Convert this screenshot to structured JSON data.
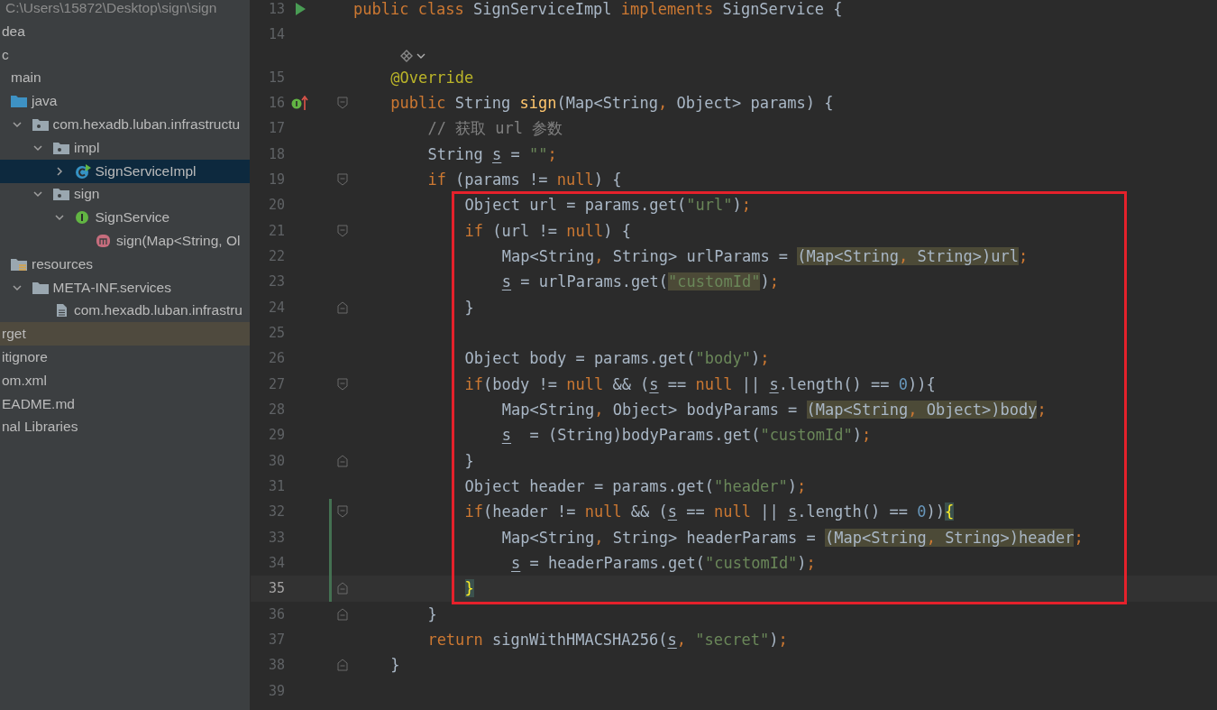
{
  "project_tree": {
    "path": "C:\\Users\\15872\\Desktop\\sign\\sign",
    "items": [
      {
        "label": "dea",
        "selected": false,
        "excluded": false
      },
      {
        "label": "c",
        "selected": false,
        "excluded": false,
        "children": [
          {
            "label": "main",
            "selected": false,
            "excluded": false,
            "children": [
              {
                "label": "java",
                "kind": "source-folder",
                "selected": false,
                "excluded": false,
                "children": [
                  {
                    "label": "com.hexadb.luban.infrastructu",
                    "kind": "package",
                    "expanded": true,
                    "selected": false,
                    "excluded": false,
                    "children": [
                      {
                        "label": "impl",
                        "kind": "package",
                        "expanded": true,
                        "selected": false,
                        "excluded": false,
                        "children": [
                          {
                            "label": "SignServiceImpl",
                            "kind": "class",
                            "expanded": false,
                            "selected": true,
                            "excluded": false
                          }
                        ]
                      },
                      {
                        "label": "sign",
                        "kind": "package",
                        "expanded": true,
                        "selected": false,
                        "excluded": false,
                        "children": [
                          {
                            "label": "SignService",
                            "kind": "interface",
                            "expanded": true,
                            "selected": false,
                            "excluded": false,
                            "children": [
                              {
                                "label": "sign(Map<String, Ol",
                                "kind": "method",
                                "selected": false,
                                "excluded": false
                              }
                            ]
                          }
                        ]
                      }
                    ]
                  }
                ]
              },
              {
                "label": "resources",
                "kind": "resources",
                "selected": false,
                "excluded": false,
                "children": [
                  {
                    "label": "META-INF.services",
                    "kind": "folder",
                    "expanded": true,
                    "selected": false,
                    "excluded": false,
                    "children": [
                      {
                        "label": "com.hexadb.luban.infrastru",
                        "kind": "file",
                        "selected": false,
                        "excluded": false
                      }
                    ]
                  }
                ]
              }
            ]
          }
        ]
      },
      {
        "label": "rget",
        "selected": false,
        "excluded": true
      },
      {
        "label": "itignore",
        "selected": false,
        "excluded": false
      },
      {
        "label": "om.xml",
        "selected": false,
        "excluded": false
      },
      {
        "label": "EADME.md",
        "selected": false,
        "excluded": false
      },
      {
        "label": "nal Libraries",
        "selected": false,
        "excluded": false
      }
    ]
  },
  "editor": {
    "lines": [
      {
        "n": "13",
        "gutter": {
          "kind": "run"
        },
        "current": false,
        "changed": false,
        "tokens": [
          {
            "t": "public class ",
            "kind": "kw"
          },
          {
            "t": "SignServiceImpl ",
            "kind": "plain"
          },
          {
            "t": "implements ",
            "kind": "kw"
          },
          {
            "t": "SignService {",
            "kind": "plain"
          }
        ],
        "children": [
          {
            "n": "14",
            "current": false,
            "changed": false
          },
          {
            "kind": "hint"
          },
          {
            "n": "15",
            "current": false,
            "changed": false,
            "tokens": [
              {
                "t": "@Override",
                "kind": "ann"
              }
            ]
          },
          {
            "n": "16",
            "gutter": {
              "kind": "implements"
            },
            "fold": {
              "kind": "start"
            },
            "current": false,
            "changed": false,
            "tokens": [
              {
                "t": "public ",
                "kind": "kw"
              },
              {
                "t": "String ",
                "kind": "plain"
              },
              {
                "t": "sign",
                "kind": "fn"
              },
              {
                "t": "(Map<String",
                "kind": "plain"
              },
              {
                "t": ", ",
                "kind": "punct"
              },
              {
                "t": "Object> params) {",
                "kind": "plain"
              }
            ],
            "children": [
              {
                "n": "17",
                "current": false,
                "changed": false,
                "tokens": [
                  {
                    "t": "// 获取 url 参数",
                    "kind": "cmt"
                  }
                ]
              },
              {
                "n": "18",
                "current": false,
                "changed": false,
                "tokens": [
                  {
                    "t": "String ",
                    "kind": "plain"
                  },
                  {
                    "t": "s",
                    "kind": "var"
                  },
                  {
                    "t": " = ",
                    "kind": "plain"
                  },
                  {
                    "t": "\"\"",
                    "kind": "str"
                  },
                  {
                    "t": ";",
                    "kind": "punct"
                  }
                ]
              },
              {
                "n": "19",
                "fold": {
                  "kind": "start"
                },
                "current": false,
                "changed": false,
                "tokens": [
                  {
                    "t": "if ",
                    "kind": "kw"
                  },
                  {
                    "t": "(params != ",
                    "kind": "plain"
                  },
                  {
                    "t": "null",
                    "kind": "kw"
                  },
                  {
                    "t": ") {",
                    "kind": "plain"
                  }
                ],
                "children": [
                  {
                    "n": "20",
                    "current": false,
                    "changed": false,
                    "tokens": [
                      {
                        "t": "Object url = params.get(",
                        "kind": "plain"
                      },
                      {
                        "t": "\"url\"",
                        "kind": "str"
                      },
                      {
                        "t": ")",
                        "kind": "plain"
                      },
                      {
                        "t": ";",
                        "kind": "punct"
                      }
                    ]
                  },
                  {
                    "n": "21",
                    "fold": {
                      "kind": "start"
                    },
                    "current": false,
                    "changed": false,
                    "tokens": [
                      {
                        "t": "if ",
                        "kind": "kw"
                      },
                      {
                        "t": "(url != ",
                        "kind": "plain"
                      },
                      {
                        "t": "null",
                        "kind": "kw"
                      },
                      {
                        "t": ") {",
                        "kind": "plain"
                      }
                    ],
                    "children": [
                      {
                        "n": "22",
                        "current": false,
                        "changed": false,
                        "tokens": [
                          {
                            "t": "Map<String",
                            "kind": "plain"
                          },
                          {
                            "t": ", ",
                            "kind": "punct"
                          },
                          {
                            "t": "String> urlParams = ",
                            "kind": "plain"
                          },
                          {
                            "t": "(Map<String",
                            "kind": "cast"
                          },
                          {
                            "t": ", ",
                            "kind": "cast-punct"
                          },
                          {
                            "t": "String>)url",
                            "kind": "cast"
                          },
                          {
                            "t": ";",
                            "kind": "punct"
                          }
                        ]
                      },
                      {
                        "n": "23",
                        "current": false,
                        "changed": false,
                        "tokens": [
                          {
                            "t": "s",
                            "kind": "var"
                          },
                          {
                            "t": " = urlParams.get(",
                            "kind": "plain"
                          },
                          {
                            "t": "\"customId\"",
                            "kind": "str-hl"
                          },
                          {
                            "t": ")",
                            "kind": "plain"
                          },
                          {
                            "t": ";",
                            "kind": "punct"
                          }
                        ]
                      }
                    ]
                  },
                  {
                    "n": "24",
                    "fold": {
                      "kind": "end"
                    },
                    "current": false,
                    "changed": false,
                    "tokens": [
                      {
                        "t": "}",
                        "kind": "plain"
                      }
                    ]
                  },
                  {
                    "n": "25",
                    "current": false,
                    "changed": false
                  },
                  {
                    "n": "26",
                    "current": false,
                    "changed": false,
                    "tokens": [
                      {
                        "t": "Object body = params.get(",
                        "kind": "plain"
                      },
                      {
                        "t": "\"body\"",
                        "kind": "str"
                      },
                      {
                        "t": ")",
                        "kind": "plain"
                      },
                      {
                        "t": ";",
                        "kind": "punct"
                      }
                    ]
                  },
                  {
                    "n": "27",
                    "fold": {
                      "kind": "start"
                    },
                    "current": false,
                    "changed": false,
                    "tokens": [
                      {
                        "t": "if",
                        "kind": "kw"
                      },
                      {
                        "t": "(body != ",
                        "kind": "plain"
                      },
                      {
                        "t": "null",
                        "kind": "kw"
                      },
                      {
                        "t": " && (",
                        "kind": "plain"
                      },
                      {
                        "t": "s",
                        "kind": "var"
                      },
                      {
                        "t": " == ",
                        "kind": "plain"
                      },
                      {
                        "t": "null",
                        "kind": "kw"
                      },
                      {
                        "t": " || ",
                        "kind": "plain"
                      },
                      {
                        "t": "s",
                        "kind": "var"
                      },
                      {
                        "t": ".length() == ",
                        "kind": "plain"
                      },
                      {
                        "t": "0",
                        "kind": "num"
                      },
                      {
                        "t": ")){",
                        "kind": "plain"
                      }
                    ],
                    "children": [
                      {
                        "n": "28",
                        "current": false,
                        "changed": false,
                        "tokens": [
                          {
                            "t": "Map<String",
                            "kind": "plain"
                          },
                          {
                            "t": ", ",
                            "kind": "punct"
                          },
                          {
                            "t": "Object> bodyParams = ",
                            "kind": "plain"
                          },
                          {
                            "t": "(Map<String",
                            "kind": "cast"
                          },
                          {
                            "t": ", ",
                            "kind": "cast-punct"
                          },
                          {
                            "t": "Object>)body",
                            "kind": "cast"
                          },
                          {
                            "t": ";",
                            "kind": "punct"
                          }
                        ]
                      },
                      {
                        "n": "29",
                        "current": false,
                        "changed": false,
                        "tokens": [
                          {
                            "t": "s",
                            "kind": "var"
                          },
                          {
                            "t": "  = (String)bodyParams.get(",
                            "kind": "plain"
                          },
                          {
                            "t": "\"customId\"",
                            "kind": "str"
                          },
                          {
                            "t": ")",
                            "kind": "plain"
                          },
                          {
                            "t": ";",
                            "kind": "punct"
                          }
                        ]
                      }
                    ]
                  },
                  {
                    "n": "30",
                    "fold": {
                      "kind": "end"
                    },
                    "current": false,
                    "changed": false,
                    "tokens": [
                      {
                        "t": "}",
                        "kind": "plain"
                      }
                    ]
                  },
                  {
                    "n": "31",
                    "current": false,
                    "changed": false,
                    "tokens": [
                      {
                        "t": "Object header = params.get(",
                        "kind": "plain"
                      },
                      {
                        "t": "\"header\"",
                        "kind": "str"
                      },
                      {
                        "t": ")",
                        "kind": "plain"
                      },
                      {
                        "t": ";",
                        "kind": "punct"
                      }
                    ]
                  },
                  {
                    "n": "32",
                    "fold": {
                      "kind": "start"
                    },
                    "current": false,
                    "changed": true,
                    "tokens": [
                      {
                        "t": "if",
                        "kind": "kw"
                      },
                      {
                        "t": "(header != ",
                        "kind": "plain"
                      },
                      {
                        "t": "null",
                        "kind": "kw"
                      },
                      {
                        "t": " && (",
                        "kind": "plain"
                      },
                      {
                        "t": "s",
                        "kind": "var"
                      },
                      {
                        "t": " == ",
                        "kind": "plain"
                      },
                      {
                        "t": "null",
                        "kind": "kw"
                      },
                      {
                        "t": " || ",
                        "kind": "plain"
                      },
                      {
                        "t": "s",
                        "kind": "var"
                      },
                      {
                        "t": ".length() == ",
                        "kind": "plain"
                      },
                      {
                        "t": "0",
                        "kind": "num"
                      },
                      {
                        "t": "))",
                        "kind": "plain"
                      },
                      {
                        "t": "{",
                        "kind": "brace"
                      }
                    ],
                    "children": [
                      {
                        "n": "33",
                        "current": false,
                        "changed": true,
                        "tokens": [
                          {
                            "t": "Map<String",
                            "kind": "plain"
                          },
                          {
                            "t": ", ",
                            "kind": "punct"
                          },
                          {
                            "t": "String> headerParams = ",
                            "kind": "plain"
                          },
                          {
                            "t": "(Map<String",
                            "kind": "cast"
                          },
                          {
                            "t": ", ",
                            "kind": "cast-punct"
                          },
                          {
                            "t": "String>)header",
                            "kind": "cast"
                          },
                          {
                            "t": ";",
                            "kind": "punct"
                          }
                        ]
                      },
                      {
                        "n": "34",
                        "current": false,
                        "changed": true,
                        "tokens": [
                          {
                            "t": " s",
                            "kind": "var"
                          },
                          {
                            "t": " = headerParams.get(",
                            "kind": "plain"
                          },
                          {
                            "t": "\"customId\"",
                            "kind": "str"
                          },
                          {
                            "t": ")",
                            "kind": "plain"
                          },
                          {
                            "t": ";",
                            "kind": "punct"
                          }
                        ]
                      }
                    ]
                  },
                  {
                    "n": "35",
                    "fold": {
                      "kind": "end"
                    },
                    "current": true,
                    "changed": true,
                    "tokens": [
                      {
                        "t": "}",
                        "kind": "brace"
                      }
                    ]
                  }
                ]
              },
              {
                "n": "36",
                "fold": {
                  "kind": "end"
                },
                "current": false,
                "changed": false,
                "tokens": [
                  {
                    "t": "}",
                    "kind": "plain"
                  }
                ]
              },
              {
                "n": "37",
                "current": false,
                "changed": false,
                "tokens": [
                  {
                    "t": "return ",
                    "kind": "kw"
                  },
                  {
                    "t": "signWithHMACSHA256(",
                    "kind": "plain"
                  },
                  {
                    "t": "s",
                    "kind": "var"
                  },
                  {
                    "t": ", ",
                    "kind": "punct"
                  },
                  {
                    "t": "\"secret\"",
                    "kind": "str"
                  },
                  {
                    "t": ")",
                    "kind": "plain"
                  },
                  {
                    "t": ";",
                    "kind": "punct"
                  }
                ]
              }
            ]
          },
          {
            "n": "38",
            "fold": {
              "kind": "end"
            },
            "current": false,
            "changed": false,
            "tokens": [
              {
                "t": "}",
                "kind": "plain"
              }
            ]
          },
          {
            "n": "39",
            "current": false,
            "changed": false
          }
        ]
      }
    ]
  }
}
